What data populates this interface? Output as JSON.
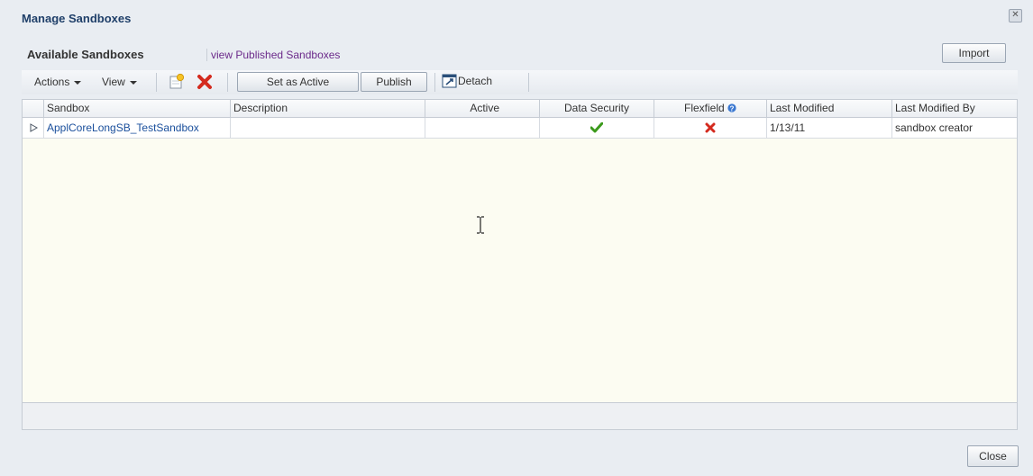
{
  "dialog": {
    "title": "Manage Sandboxes",
    "close_button_label": "Close"
  },
  "panel": {
    "title": "Available Sandboxes",
    "link": "view Published Sandboxes",
    "import_label": "Import"
  },
  "toolbar": {
    "actions_label": "Actions",
    "view_label": "View",
    "set_active_label": "Set as Active",
    "publish_label": "Publish",
    "detach_label": "Detach"
  },
  "table": {
    "columns": [
      "Sandbox",
      "Description",
      "Active",
      "Data Security",
      "Flexfield",
      "Last Modified",
      "Last Modified By"
    ],
    "rows": [
      {
        "sandbox": "ApplCoreLongSB_TestSandbox",
        "description": "",
        "active": "",
        "data_security": "check-icon",
        "flexfield": "cross-icon",
        "last_modified": "1/13/11",
        "last_modified_by": "sandbox creator"
      }
    ]
  },
  "colors": {
    "title": "#1f3f69",
    "link": "#6b2a8a",
    "sandbox_link": "#1a4f9c",
    "check": "#3c9a1c",
    "cross": "#d42a1e"
  }
}
